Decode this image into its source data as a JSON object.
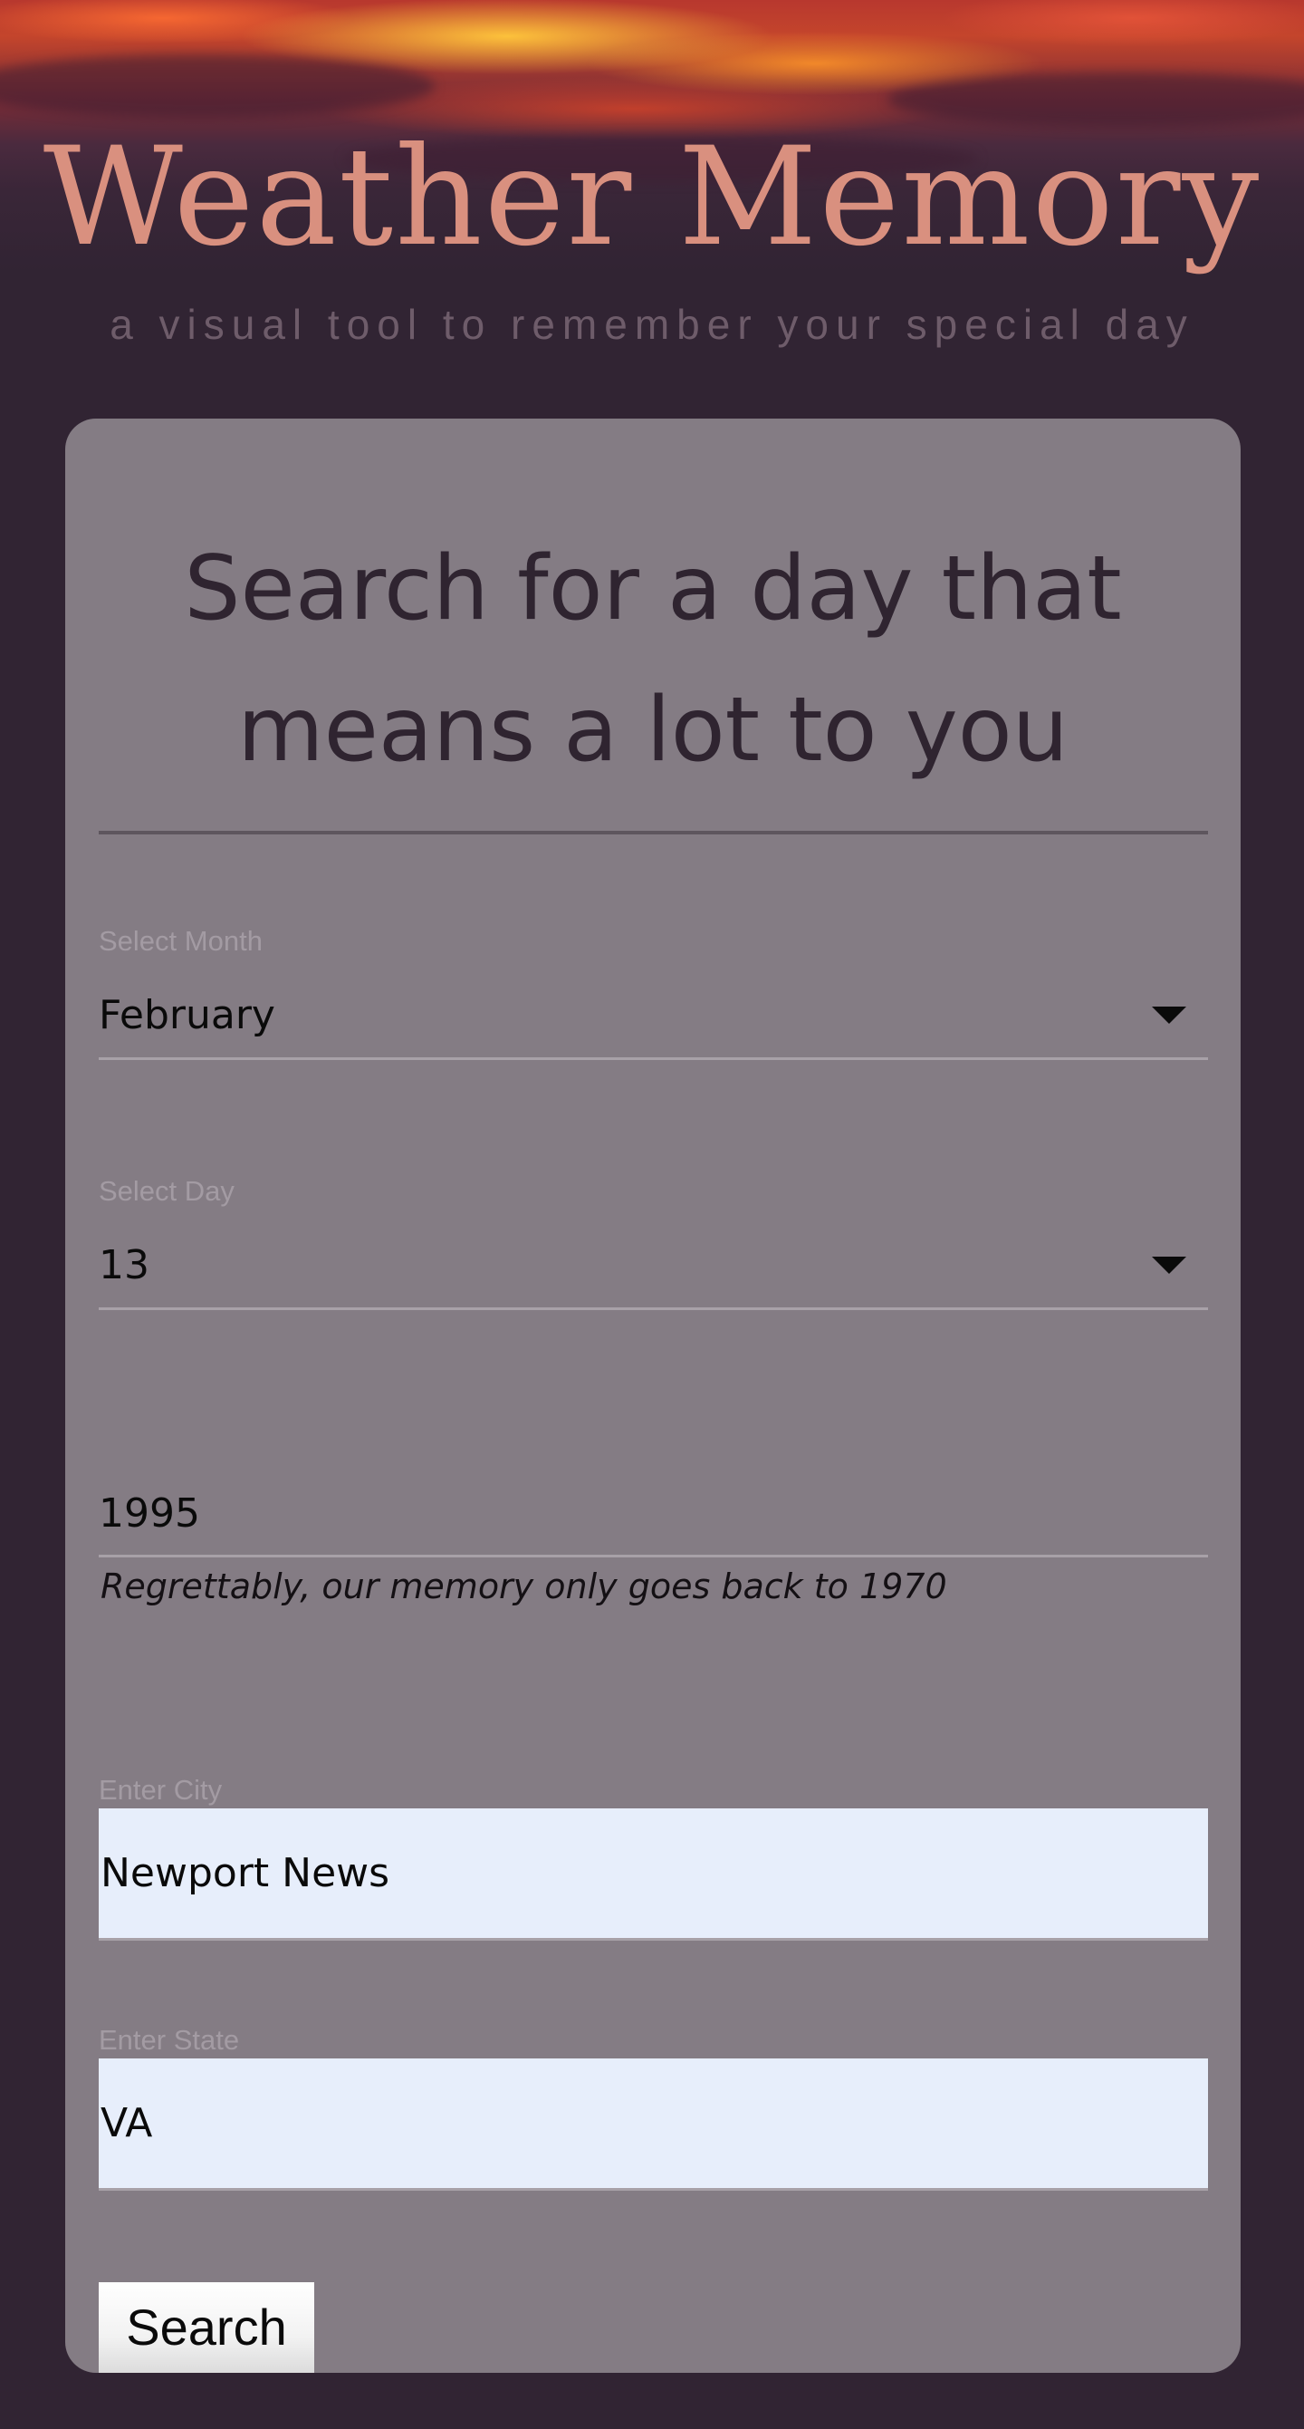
{
  "header": {
    "title": "Weather Memory",
    "subtitle": "a visual tool to remember your special day"
  },
  "form": {
    "heading": "Search for a day that means a lot to you",
    "month": {
      "label": "Select Month",
      "value": "February"
    },
    "day": {
      "label": "Select Day",
      "value": "13"
    },
    "year": {
      "value": "1995",
      "helper": "Regrettably, our memory only goes back to 1970"
    },
    "city": {
      "label": "Enter City",
      "value": "Newport News"
    },
    "state": {
      "label": "Enter State",
      "value": "VA"
    },
    "submit_label": "Search"
  },
  "colors": {
    "background": "#312433",
    "card": "#847c84",
    "title": "#d9907f",
    "input_fill": "#e7eefb"
  },
  "icons": {
    "select_caret": "caret-down-icon"
  }
}
